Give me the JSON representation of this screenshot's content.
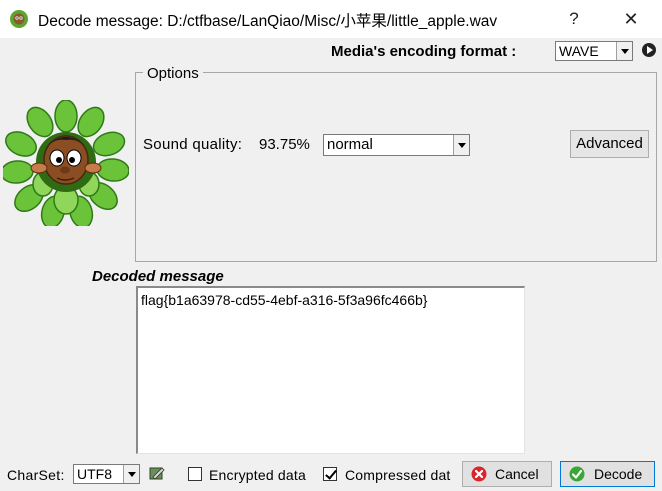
{
  "window": {
    "title": "Decode message: D:/ctfbase/LanQiao/Misc/小苹果/little_apple.wav",
    "help_label": "?",
    "close_label": "✕"
  },
  "media": {
    "label": "Media's encoding format :",
    "format_value": "WAVE"
  },
  "options": {
    "legend": "Options",
    "quality_label": "Sound quality:",
    "quality_value": "93.75%",
    "quality_select": "normal",
    "advanced_label": "Advanced"
  },
  "decoded": {
    "label": "Decoded message",
    "message": "flag{b1a63978-cd55-4ebf-a316-5f3a96fc466b}"
  },
  "bottom": {
    "charset_label": "CharSet:",
    "charset_value": "UTF8",
    "encrypted_label": "Encrypted data",
    "encrypted_checked": false,
    "compressed_label": "Compressed dat",
    "compressed_checked": true,
    "cancel_label": "Cancel",
    "decode_label": "Decode"
  },
  "icons": {
    "app": "mascot-icon",
    "charset": "edit-icon",
    "cancel": "cancel-icon",
    "decode": "check-icon",
    "play": "play-icon"
  },
  "colors": {
    "titlebar": "#ffffff",
    "window_bg": "#f0f0f0",
    "cancel_icon": "#d9262c",
    "decode_icon": "#3aa635",
    "leaf": "#6bc33a"
  }
}
